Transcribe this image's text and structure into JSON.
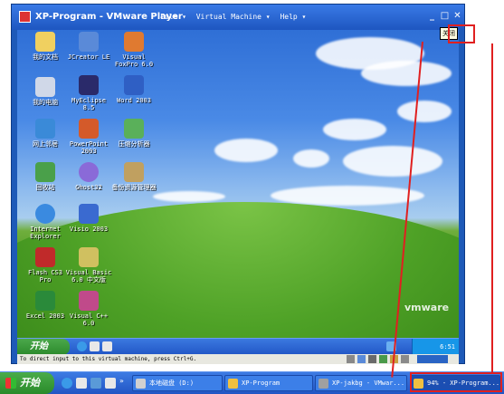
{
  "window": {
    "title": "XP-Program - VMware Player",
    "menu": [
      "File ▾",
      "Virtual Machine ▾",
      "Help ▾"
    ],
    "tooltip": "关闭"
  },
  "desktop_icons": [
    {
      "label": "我的文档",
      "color": "#f0d060"
    },
    {
      "label": "JCreator LE",
      "color": "#5a8ad8"
    },
    {
      "label": "Visual\nFoxPro 6.0",
      "color": "#e07a30"
    },
    {
      "label": "我的电脑",
      "color": "#d0d8e8"
    },
    {
      "label": "MyEclipse\n8.5",
      "color": "#2a2a6a"
    },
    {
      "label": "Word 2003",
      "color": "#2f5fc4"
    },
    {
      "label": "网上邻居",
      "color": "#3a8ad8"
    },
    {
      "label": "PowerPoint\n2003",
      "color": "#d45a2a"
    },
    {
      "label": "压缩分析器",
      "color": "#5ab05a"
    },
    {
      "label": "回收站",
      "color": "#4aa04a"
    },
    {
      "label": "Ghost32",
      "color": "#8a6ad8"
    },
    {
      "label": "备份资源管理器",
      "color": "#c0a060"
    },
    {
      "label": "Internet\nExplorer",
      "color": "#3a8ae0"
    },
    {
      "label": "Visio 2003",
      "color": "#3a6ad0"
    },
    {
      "label": "Flash CS3\nPro",
      "color": "#c02a2a"
    },
    {
      "label": "Visual Basic\n6.0 中文版",
      "color": "#d0c060"
    },
    {
      "label": "Excel 2003",
      "color": "#2a8a3a"
    },
    {
      "label": "Visual C++\n6.0",
      "color": "#c04a8a"
    }
  ],
  "guest_taskbar": {
    "start_label": "开始",
    "clock": "6:51"
  },
  "statusbar": {
    "text": "To direct input to this virtual machine, press Ctrl+G."
  },
  "vmware_logo": "vmware",
  "host_taskbar": {
    "start_label": "开始",
    "buttons": [
      {
        "label": "本地磁盘 (D:)",
        "icon_color": "#d0d0d0"
      },
      {
        "label": "XP-Program",
        "icon_color": "#f0c040"
      },
      {
        "label": "XP-jakbg - VMwar...",
        "icon_color": "#a0a0a0"
      },
      {
        "label": "94% - XP-Program...",
        "icon_color": "#f0c040"
      }
    ]
  }
}
